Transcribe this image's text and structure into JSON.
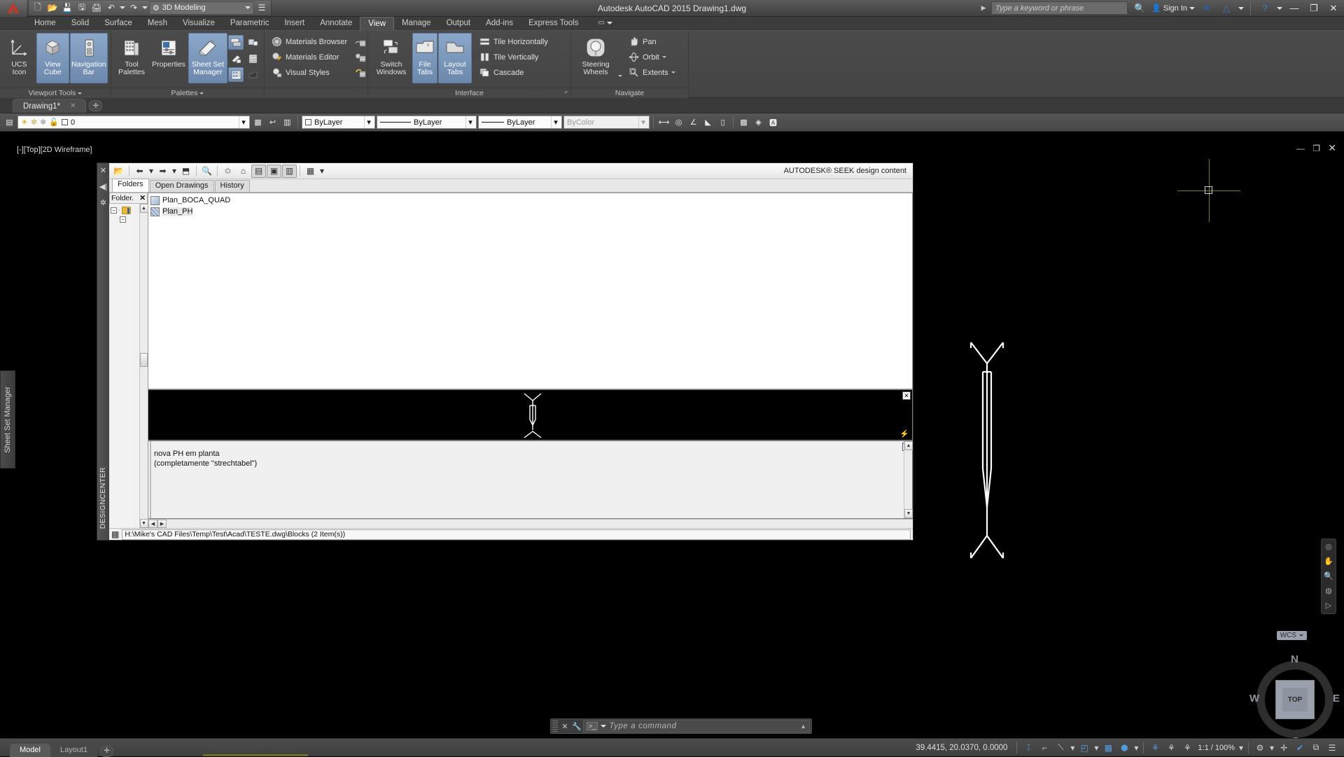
{
  "app": {
    "title": "Autodesk AutoCAD 2015    Drawing1.dwg",
    "workspace": "3D Modeling",
    "search_placeholder": "Type a keyword or phrase",
    "sign_in": "Sign In"
  },
  "quick_access": [
    {
      "name": "new-icon",
      "glyph": "🗋"
    },
    {
      "name": "open-icon",
      "glyph": "📂"
    },
    {
      "name": "save-icon",
      "glyph": "💾"
    },
    {
      "name": "save-as-icon",
      "glyph": "🖫"
    },
    {
      "name": "plot-icon",
      "glyph": "🖨"
    },
    {
      "name": "undo-icon",
      "glyph": "↶"
    },
    {
      "name": "redo-icon",
      "glyph": "↷"
    }
  ],
  "ribbon": {
    "tabs": [
      {
        "label": "Home",
        "active": false
      },
      {
        "label": "Solid",
        "active": false
      },
      {
        "label": "Surface",
        "active": false
      },
      {
        "label": "Mesh",
        "active": false
      },
      {
        "label": "Visualize",
        "active": false
      },
      {
        "label": "Parametric",
        "active": false
      },
      {
        "label": "Insert",
        "active": false
      },
      {
        "label": "Annotate",
        "active": false
      },
      {
        "label": "View",
        "active": true
      },
      {
        "label": "Manage",
        "active": false
      },
      {
        "label": "Output",
        "active": false
      },
      {
        "label": "Add-ins",
        "active": false
      },
      {
        "label": "Express Tools",
        "active": false
      }
    ],
    "panels": [
      {
        "title": "Viewport Tools",
        "buttons": [
          {
            "label1": "UCS",
            "label2": "Icon",
            "selected": false,
            "icon": "ucs-icon"
          },
          {
            "label1": "View",
            "label2": "Cube",
            "selected": true,
            "icon": "viewcube-icon"
          },
          {
            "label1": "Navigation",
            "label2": "Bar",
            "selected": true,
            "icon": "navbar-icon"
          }
        ]
      },
      {
        "title": "Palettes",
        "buttons": [
          {
            "label1": "Tool",
            "label2": "Palettes",
            "selected": false,
            "icon": "tool-palettes-icon"
          },
          {
            "label1": "Properties",
            "label2": "",
            "selected": false,
            "icon": "properties-icon"
          },
          {
            "label1": "Sheet Set",
            "label2": "Manager",
            "selected": true,
            "icon": "sheet-set-manager-icon"
          }
        ],
        "small_items": [
          {
            "label": "Materials Browser",
            "icon": "materials-browser-icon"
          },
          {
            "label": "Materials Editor",
            "icon": "materials-editor-icon"
          },
          {
            "label": "Visual Styles",
            "icon": "visual-styles-icon"
          }
        ]
      },
      {
        "title": "Interface",
        "buttons": [
          {
            "label1": "Switch",
            "label2": "Windows",
            "selected": false,
            "icon": "switch-windows-icon"
          },
          {
            "label1": "File",
            "label2": "Tabs",
            "selected": true,
            "icon": "file-tabs-icon"
          },
          {
            "label1": "Layout",
            "label2": "Tabs",
            "selected": true,
            "icon": "layout-tabs-icon"
          }
        ],
        "small_items": [
          {
            "label": "Tile Horizontally",
            "icon": "tile-horizontally-icon"
          },
          {
            "label": "Tile Vertically",
            "icon": "tile-vertically-icon"
          },
          {
            "label": "Cascade",
            "icon": "cascade-icon"
          }
        ]
      },
      {
        "title": "Navigate",
        "buttons": [
          {
            "label1": "Steering",
            "label2": "Wheels",
            "selected": false,
            "icon": "steering-wheels-icon"
          }
        ],
        "small_items": [
          {
            "label": "Pan",
            "icon": "pan-icon"
          },
          {
            "label": "Orbit",
            "icon": "orbit-icon"
          },
          {
            "label": "Extents",
            "icon": "extents-icon"
          }
        ]
      }
    ]
  },
  "file_tabs": [
    {
      "label": "Drawing1*",
      "active": true
    }
  ],
  "properties_toolbar": {
    "layer_value": "0",
    "color_value": "ByLayer",
    "linetype_value": "ByLayer",
    "lineweight_value": "ByLayer",
    "plotstyle_value": "ByColor"
  },
  "viewport": {
    "label": "[-][Top][2D Wireframe]",
    "wcs_label": "WCS",
    "compass": {
      "n": "N",
      "e": "E",
      "s": "S",
      "w": "W",
      "face": "TOP"
    }
  },
  "sheet_set_side_tab": "Sheet Set Manager",
  "designcenter": {
    "vertical_title": "DESIGNCENTER",
    "tabs": [
      {
        "label": "Folders",
        "active": true
      },
      {
        "label": "Open Drawings",
        "active": false
      },
      {
        "label": "History",
        "active": false
      }
    ],
    "tree_header": "Folder.",
    "blocks": [
      {
        "name": "Plan_BOCA_QUAD"
      },
      {
        "name": "Plan_PH"
      }
    ],
    "description": "nova PH em planta\n(completamente \"strechtabel\")",
    "status_path": "H:\\Mike's CAD Files\\Temp\\Test\\Acad\\TESTE.dwg\\Blocks (2 Item(s))",
    "seek_text": "AUTODESK® SEEK design content"
  },
  "command_line": {
    "placeholder": "Type a command",
    "prompt_glyph": ">_"
  },
  "status_bar": {
    "model_tab": "Model",
    "layout_tab": "Layout1",
    "coordinates": "39.4415, 20.0370, 0.0000",
    "scale": "1:1 / 100%"
  },
  "colors": {
    "accent_blue": "#4f9de0",
    "ribbon_selected": "#7b97bb",
    "canvas_bg": "#000000",
    "crosshair": "#7d7d3a"
  }
}
